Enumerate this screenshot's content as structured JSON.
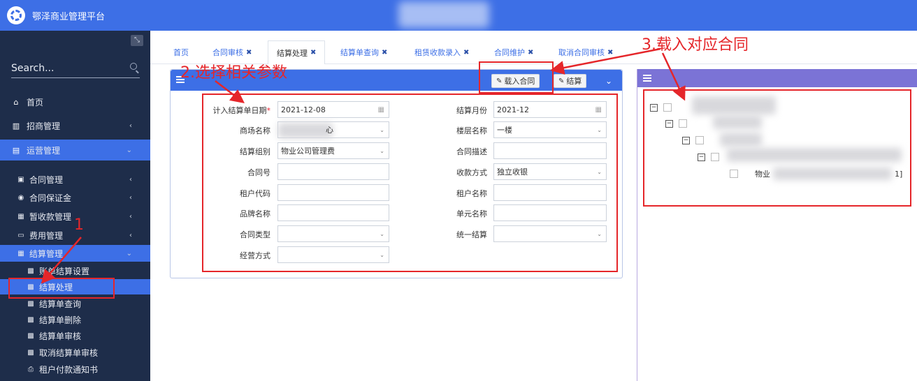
{
  "app": {
    "title": "鄂泽商业管理平台"
  },
  "sidebar": {
    "search_placeholder": "Search...",
    "items": [
      {
        "icon": "home-icon",
        "glyph": "⌂",
        "label": "首页"
      },
      {
        "icon": "chart-icon",
        "glyph": "▥",
        "label": "招商管理",
        "chev": "‹"
      },
      {
        "icon": "monitor-icon",
        "glyph": "▤",
        "label": "运营管理",
        "chev": "⌄"
      }
    ],
    "sub": [
      {
        "glyph": "▣",
        "label": "合同管理",
        "chev": "‹"
      },
      {
        "glyph": "◉",
        "label": "合同保证金",
        "chev": "‹"
      },
      {
        "glyph": "▦",
        "label": "暂收款管理",
        "chev": "‹"
      },
      {
        "glyph": "▭",
        "label": "费用管理",
        "chev": "‹"
      },
      {
        "glyph": "▦",
        "label": "结算管理",
        "chev": "⌄"
      }
    ],
    "leaves": [
      {
        "glyph": "▩",
        "label": "账单结算设置"
      },
      {
        "glyph": "▩",
        "label": "结算处理"
      },
      {
        "glyph": "▩",
        "label": "结算单查询"
      },
      {
        "glyph": "▩",
        "label": "结算单删除"
      },
      {
        "glyph": "▩",
        "label": "结算单审核"
      },
      {
        "glyph": "▩",
        "label": "取消结算单审核"
      },
      {
        "glyph": "⎙",
        "label": "租户付款通知书"
      }
    ]
  },
  "tabs": [
    {
      "label": "首页",
      "closable": false
    },
    {
      "label": "合同审核",
      "closable": true
    },
    {
      "label": "结算处理",
      "closable": true,
      "active": true
    },
    {
      "label": "结算单查询",
      "closable": true
    },
    {
      "label": "租赁收款录入",
      "closable": true
    },
    {
      "label": "合同维护",
      "closable": true
    },
    {
      "label": "取消合同审核",
      "closable": true
    }
  ],
  "toolbar": {
    "load_contract": "载入合同",
    "settle": "结算"
  },
  "form": {
    "settle_date_label": "计入结算单日期",
    "settle_date": "2021-12-08",
    "settle_month_label": "结算月份",
    "settle_month": "2021-12",
    "mall_label": "商场名称",
    "mall_value_tail": "心",
    "floor_label": "楼层名称",
    "floor_value": "一楼",
    "group_label": "结算组别",
    "group_value": "物业公司管理费",
    "desc_label": "合同描述",
    "contract_no_label": "合同号",
    "pay_label": "收款方式",
    "pay_value": "独立收银",
    "tenant_code_label": "租户代码",
    "tenant_name_label": "租户名称",
    "brand_label": "品牌名称",
    "unit_label": "单元名称",
    "contract_type_label": "合同类型",
    "unified_label": "统一结算",
    "biz_label": "经营方式"
  },
  "tree": {
    "leaf_prefix": "物业",
    "leaf_suffix": "1]"
  },
  "annotations": {
    "step1": "1",
    "step2": "2.选择相关参数",
    "step3": "3.载入对应合同"
  }
}
